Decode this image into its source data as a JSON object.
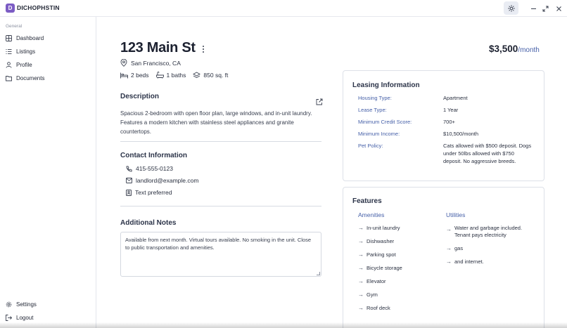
{
  "app": {
    "logo_letter": "D",
    "name": "DICHOPHSTIN"
  },
  "window_controls": [
    "sun-icon",
    "minimize-icon",
    "restore-icon",
    "close-icon"
  ],
  "sidebar": {
    "group_label": "General",
    "items": [
      {
        "label": "Dashboard",
        "icon": "grid-icon"
      },
      {
        "label": "Listings",
        "icon": "list-icon"
      },
      {
        "label": "Profile",
        "icon": "user-icon"
      },
      {
        "label": "Documents",
        "icon": "folder-icon"
      }
    ],
    "bottom_items": [
      {
        "label": "Settings",
        "icon": "gear-icon"
      },
      {
        "label": "Logout",
        "icon": "logout-icon"
      }
    ]
  },
  "listing": {
    "address": "123 Main St",
    "price": "$3,500",
    "price_period": "/month",
    "location": "San Francisco, CA",
    "beds": "2 beds",
    "baths": "1 baths",
    "area": "850 sq. ft"
  },
  "description": {
    "title": "Description",
    "text": "Spacious 2-bedroom with open floor plan, large windows, and in-unit laundry. Features a modern kitchen with stainless steel appliances and granite countertops."
  },
  "contact": {
    "title": "Contact Information",
    "phone": "415-555-0123",
    "email": "landlord@example.com",
    "preference": "Text preferred"
  },
  "notes": {
    "title": "Additional Notes",
    "text": "Available from next month. Virtual tours available. No smoking in the unit. Close to public transportation and amenities."
  },
  "leasing": {
    "title": "Leasing Information",
    "rows": [
      {
        "key": "Housing Type:",
        "value": "Apartment"
      },
      {
        "key": "Lease Type:",
        "value": "1 Year"
      },
      {
        "key": "Minimum Credit Score:",
        "value": "700+"
      },
      {
        "key": "Minimum Income:",
        "value": "$10,500/month"
      },
      {
        "key": "Pet Policy:",
        "value": "Cats allowed with $500 deposit. Dogs under 50lbs allowed with $750 deposit. No aggressive breeds."
      }
    ]
  },
  "features": {
    "title": "Features",
    "amenities_title": "Amenities",
    "amenities": [
      "In-unit laundry",
      "Dishwasher",
      "Parking spot",
      "Bicycle storage",
      "Elevator",
      "Gym",
      "Roof deck"
    ],
    "utilities_title": "Utilities",
    "utilities": [
      "Water and garbage included. Tenant pays electricity",
      "gas",
      "and internet."
    ]
  },
  "colors": {
    "accent": "#4660a8",
    "brand": "#7c5cc4",
    "text": "#1f2433"
  }
}
